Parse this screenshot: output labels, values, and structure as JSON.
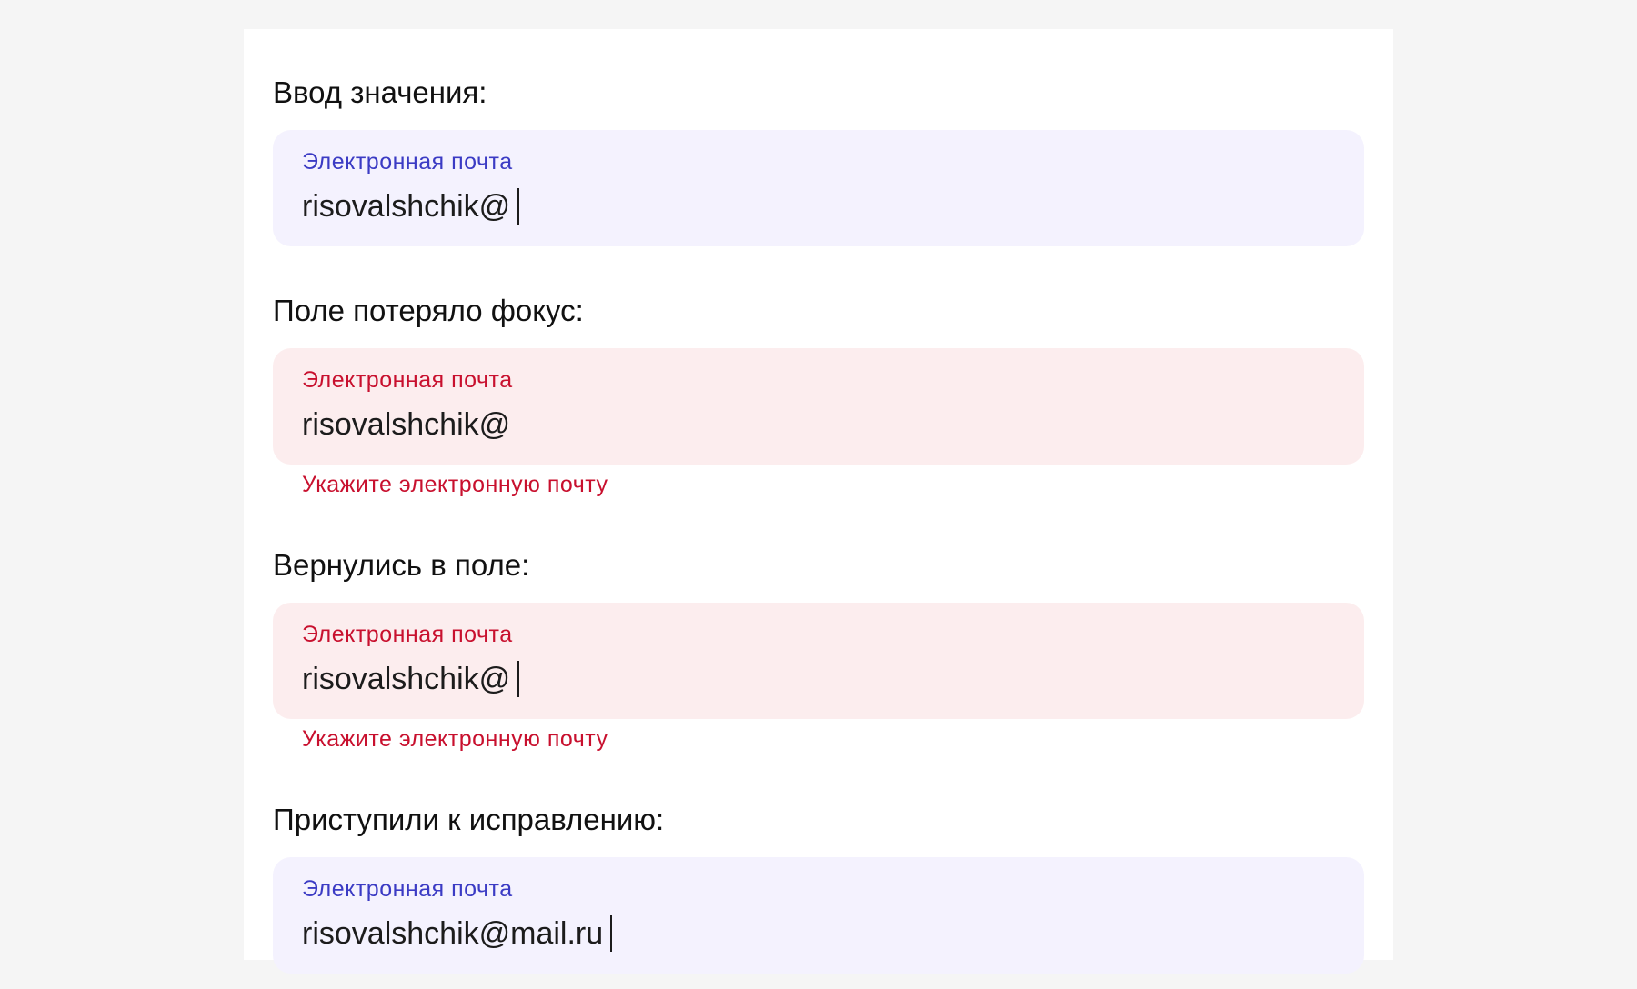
{
  "colors": {
    "page_background": "#f5f5f5",
    "panel_background": "#ffffff",
    "focused_field_background": "#f4f2fe",
    "focused_label": "#3b3bc4",
    "error_field_background": "#fcedee",
    "error_text": "#c8102e",
    "value_text": "#1c1c1c"
  },
  "states": [
    {
      "heading": "Ввод значения:",
      "field_label": "Электронная почта",
      "value": "risovalshchik@",
      "state": "focused",
      "caret_visible": true
    },
    {
      "heading": "Поле потеряло фокус:",
      "field_label": "Электронная почта",
      "value": "risovalshchik@",
      "state": "error",
      "caret_visible": false,
      "error": "Укажите электронную почту"
    },
    {
      "heading": "Вернулись в поле:",
      "field_label": "Электронная почта",
      "value": "risovalshchik@",
      "state": "error",
      "caret_visible": true,
      "error": "Укажите электронную почту"
    },
    {
      "heading": "Приступили к исправлению:",
      "field_label": "Электронная почта",
      "value": "risovalshchik@mail.ru",
      "state": "focused",
      "caret_visible": true
    }
  ]
}
